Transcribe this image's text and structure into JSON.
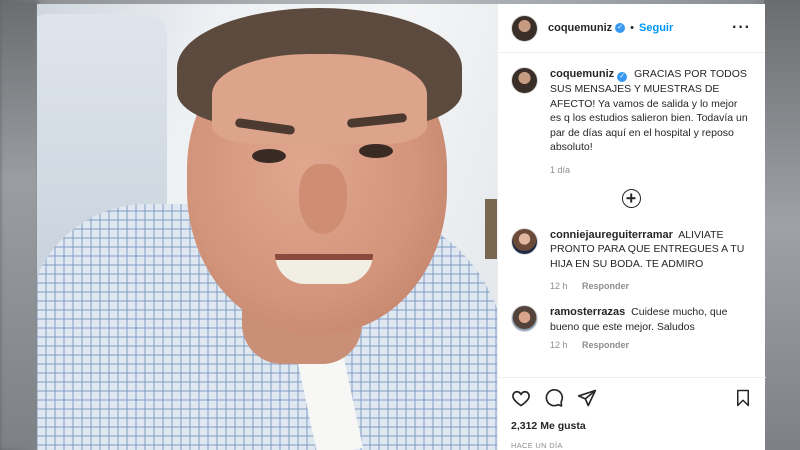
{
  "post": {
    "author": "coquemuniz",
    "follow_label": "Seguir",
    "more_icon": "more-options-icon"
  },
  "caption": {
    "username": "coquemuniz",
    "text": "GRACIAS POR TODOS SUS MENSAJES Y MUESTRAS DE AFECTO! Ya vamos de salida y lo mejor es q los estudios salieron bien. Todavía un par de días aquí en el hospital y reposo absoluto!",
    "time": "1 día"
  },
  "comments": [
    {
      "username": "conniejaureguiterramar",
      "text": "ALIVIATE PRONTO PARA QUE ENTREGUES A TU HIJA EN SU BODA. TE ADMIRO",
      "time": "12 h",
      "reply_label": "Responder"
    },
    {
      "username": "ramosterrazas",
      "text": "Cuidese mucho, que bueno que este mejor. Saludos",
      "time": "12 h",
      "reply_label": "Responder"
    }
  ],
  "stats": {
    "likes": "2,312 Me gusta",
    "posted": "HACE UN DÍA"
  },
  "colors": {
    "link": "#0095f6",
    "verified": "#3897f0",
    "text": "#262626",
    "muted": "#8e8e8e"
  }
}
